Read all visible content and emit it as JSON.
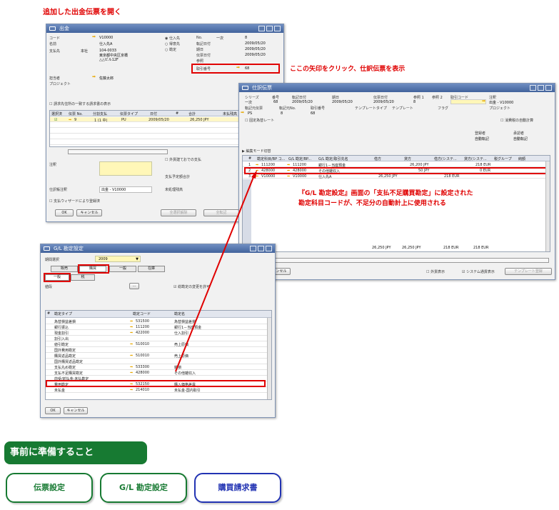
{
  "heading_top": "追加した出金伝票を開く",
  "callout_arrow": "ここの矢印をクリック、仕訳伝票を表示",
  "callout_gl_line1": "『G/L 勘定設定』画面の「支払不足購買勘定」に設定された",
  "callout_gl_line2": "勘定科目コードが、不足分の自動計上に使用される",
  "payment": {
    "title": "出金",
    "code_label": "コード",
    "code_value": "V10000",
    "name_label": "名前",
    "name_value": "仕入先A",
    "payee_label": "支払先",
    "payee_value": "本社",
    "address": [
      "104-0033",
      "東京都中央区京橋",
      "△△ビル12F"
    ],
    "radio_vendor": "仕入先",
    "radio_customer": "得意先",
    "radio_account": "勘定",
    "no_label": "No.",
    "no_series": "一次",
    "no_value": "8",
    "posting_date_label": "転記日付",
    "posting_date": "2009/05/20",
    "due_date_label": "期日",
    "due_date": "2009/05/20",
    "doc_date_label": "伝票日付",
    "doc_date": "2009/05/20",
    "ref_label": "参照",
    "journal_label": "取引番号",
    "journal_value": "68",
    "contact_label": "担当者",
    "contact_value": "佐藤太郎",
    "project_label": "プロジェクト",
    "check_invoice": "請求先住所の一致する請求書の表示",
    "grid_headers": [
      "選択済",
      "伝票 No.",
      "分割支払",
      "伝票タイプ",
      "日付",
      "#",
      "合計",
      "未払残高"
    ],
    "grid_row": [
      "",
      "9",
      "1 (1 中)",
      "PU",
      "2009/05/20",
      "",
      "26,250 JPY",
      ""
    ],
    "remarks_label": "注釈",
    "remarks_value": "",
    "journal_remarks_label": "仕訳帳注釈",
    "journal_remarks_value": "出金 - V10000",
    "check_foreign": "外貨建ておでの支払",
    "total_label": "支払予定額合計",
    "open_label": "未処理残高",
    "check_draft": "支払ウィザードにより登録済",
    "ok": "OK",
    "cancel": "キャンセル",
    "btn_all_clear": "全選択解除",
    "btn_payment": "全転記"
  },
  "journal": {
    "title": "仕訳伝票",
    "h_series": "シリーズ",
    "series": "一次",
    "h_number": "番号",
    "number": "68",
    "h_posting": "転記日付",
    "posting": "2009/05/20",
    "h_due": "期日",
    "due": "2009/05/20",
    "h_docdate": "伝票日付",
    "docdate": "2009/05/20",
    "h_ref1": "参照 1",
    "ref1": "8",
    "h_ref2": "参照 2",
    "h_trans": "取引コード",
    "h_remarks": "注釈",
    "remarks": "出金 - V10000",
    "h_origin": "転記元伝票",
    "origin": "PS",
    "h_origin_no": "転記元No.",
    "origin_no": "8",
    "h_trans_no": "取引番号",
    "trans_no": "68",
    "h_template_type": "テンプレートタイプ",
    "h_template": "テンプレート",
    "h_indicator": "フラグ",
    "h_project": "プロジェクト",
    "chk_fixed_rate": "固定為替レート",
    "chk_auto_tax": "消費税の自動計算",
    "reg_label": "登録者",
    "reg_value": "自動転記",
    "upd_label": "承認者",
    "upd_value": "自動転記",
    "edit_mode": "編集モード切替",
    "grid_headers": [
      "#",
      "勘定科目/BP コ...",
      "G/L 勘定/BP...",
      "G/L 勘定/取引先名",
      "借方",
      "貸方",
      "借方(システ...",
      "貸方(システ...",
      "税グループ",
      "純額"
    ],
    "rows": [
      [
        "1",
        "111200",
        "111200",
        "銀行1－当座預金",
        "",
        "26,200 JPY",
        "",
        "218 EUR",
        "",
        ""
      ],
      [
        "2",
        "428000",
        "428000",
        "その他雑収入",
        "",
        "50 JPY",
        "",
        "0 EUR",
        "",
        ""
      ],
      [
        "3",
        "V10000",
        "V10000",
        "仕入先A",
        "26,250 JPY",
        "",
        "218 EUR",
        "",
        "",
        ""
      ]
    ],
    "totals": [
      "26,250 JPY",
      "26,250 JPY",
      "218 EUR",
      "218 EUR"
    ],
    "ok": "OK",
    "cancel": "キャンセル",
    "chk_foreign": "外貨表示",
    "chk_system": "システム通貨表示",
    "btn_template": "テンプレート登録"
  },
  "gl": {
    "title": "G/L 勘定設定",
    "period_label": "期間選択",
    "period_value": "2009",
    "tabs": [
      "販売",
      "購買",
      "一般",
      "在庫"
    ],
    "subtabs": [
      "一般",
      "税"
    ],
    "filter_label": "値段",
    "chk_edit": "総勘定の変更を許可",
    "col_type": "勘定タイプ",
    "col_code": "勘定コード",
    "col_name": "勘定名",
    "rows": [
      [
        "為替損益差損",
        "531500",
        "為替損益差損"
      ],
      [
        "銀行振込",
        "111200",
        "銀行1－当座預金"
      ],
      [
        "現金割引",
        "422000",
        "仕入割引"
      ],
      [
        "割引入出",
        "",
        ""
      ],
      [
        "値引勘定",
        "510010",
        "売上原価"
      ],
      [
        "国外費用勘定",
        "",
        ""
      ],
      [
        "購買返品勘定",
        "510010",
        "売上原価"
      ],
      [
        "国外購買返品勘定",
        "",
        ""
      ],
      [
        "支払丸め勘定",
        "533300",
        "雑損"
      ],
      [
        "支払不足購買勘定",
        "428000",
        "その他雑収入"
      ],
      [
        "前受/前払金:未払勘定",
        "",
        ""
      ],
      [
        "費用勘定",
        "532150",
        "購入価格差異"
      ],
      [
        "未払金",
        "214010",
        "未払金-国内取引"
      ]
    ],
    "ok": "OK",
    "cancel": "キャンセル"
  },
  "prep": {
    "title": "事前に準備すること",
    "buttons": [
      "伝票設定",
      "G/L 勘定設定",
      "購買請求書"
    ]
  }
}
